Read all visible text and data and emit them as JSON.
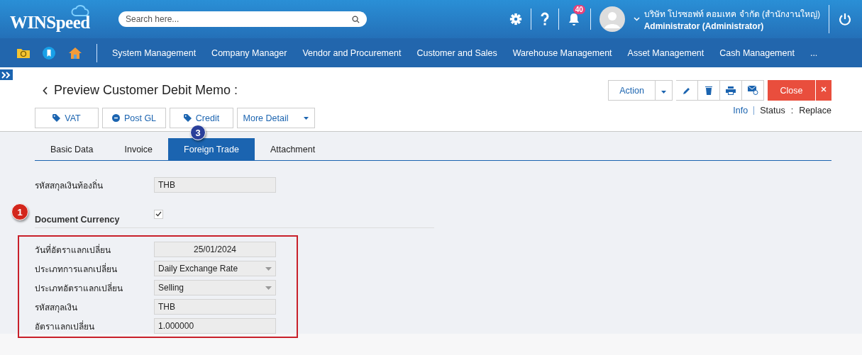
{
  "header": {
    "logo": "WINSpeed",
    "search": {
      "placeholder": "Search here..."
    },
    "notifications": "40",
    "company": "บริษัท โปรซอฟท์ คอมเทค จำกัด (สำนักงานใหญ่)",
    "user": "Administrator (Administrator)"
  },
  "menu": [
    "System Management",
    "Company Manager",
    "Vendor and Procurement",
    "Customer and Sales",
    "Warehouse Management",
    "Asset Management",
    "Cash Management",
    "..."
  ],
  "page": {
    "title": "Preview Customer Debit Memo :",
    "buttons": [
      {
        "label": "VAT",
        "kind": "tag"
      },
      {
        "label": "Post GL",
        "kind": "gl"
      },
      {
        "label": "Credit",
        "kind": "tag"
      },
      {
        "label": "More Detail",
        "kind": "dropdown"
      }
    ],
    "action": "Action",
    "close": "Close",
    "info": "Info",
    "status_label": "Status",
    "status_separator": ":",
    "status_value": "Replace"
  },
  "tabs": [
    {
      "label": "Basic Data",
      "selected": false
    },
    {
      "label": "Invoice",
      "selected": false
    },
    {
      "label": "Foreign Trade",
      "selected": true
    },
    {
      "label": "Attachment",
      "selected": false
    }
  ],
  "markers": {
    "tabs": "3",
    "section": "1"
  },
  "local_currency": {
    "label": "รหัสสกุลเงินท้องถิ่น",
    "value": "THB"
  },
  "document_currency": {
    "label": "Document Currency",
    "checked": true
  },
  "fields": [
    {
      "label": "วันที่อัตราแลกเปลี่ยน",
      "value": "25/01/2024",
      "kind": "date"
    },
    {
      "label": "ประเภทการแลกเปลี่ยน",
      "value": "Daily Exchange Rate",
      "kind": "select"
    },
    {
      "label": "ประเภทอัตราแลกเปลี่ยน",
      "value": "Selling",
      "kind": "select"
    },
    {
      "label": "รหัสสกุลเงิน",
      "value": "THB",
      "kind": "text"
    },
    {
      "label": "อัตราแลกเปลี่ยน",
      "value": "1.000000",
      "kind": "text"
    }
  ]
}
